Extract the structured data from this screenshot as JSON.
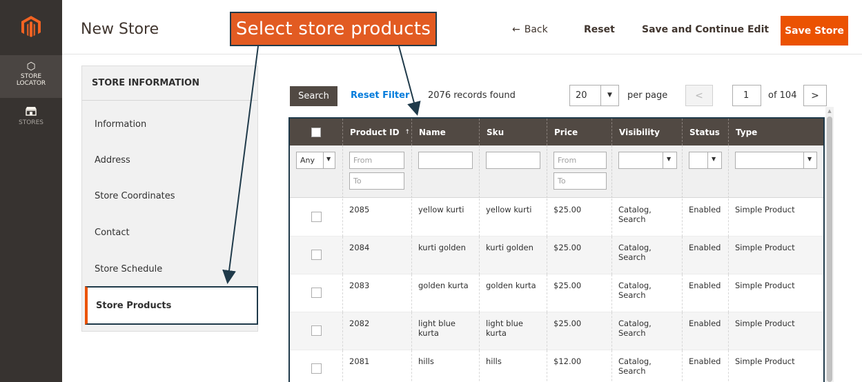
{
  "nav": {
    "items": [
      {
        "label_1": "STORE",
        "label_2": "LOCATOR",
        "icon": "hexagon-icon"
      },
      {
        "label_1": "STORES",
        "icon": "storefront-icon"
      }
    ]
  },
  "header": {
    "title": "New Store",
    "back_label": "Back",
    "reset_label": "Reset",
    "save_continue_label": "Save and Continue Edit",
    "save_label": "Save Store"
  },
  "callout": {
    "text": "Select store products",
    "color": "#e25b22"
  },
  "store_info": {
    "title": "STORE INFORMATION",
    "items": [
      "Information",
      "Address",
      "Store Coordinates",
      "Contact",
      "Store Schedule",
      "Store Products"
    ],
    "active": "Store Products"
  },
  "toolbar": {
    "search_label": "Search",
    "reset_filter_label": "Reset Filter",
    "records_text": "2076 records found",
    "per_page_value": "20",
    "per_page_label": "per page",
    "page_value": "1",
    "page_of": "of 104"
  },
  "grid": {
    "columns": [
      "Product ID",
      "Name",
      "Sku",
      "Price",
      "Visibility",
      "Status",
      "Type"
    ],
    "filters": {
      "select_any": "Any",
      "from_placeholder": "From",
      "to_placeholder": "To"
    },
    "rows": [
      {
        "id": "2085",
        "name": "yellow kurti",
        "sku": "yellow kurti",
        "price": "$25.00",
        "visibility": "Catalog, Search",
        "status": "Enabled",
        "type": "Simple Product"
      },
      {
        "id": "2084",
        "name": "kurti golden",
        "sku": "kurti golden",
        "price": "$25.00",
        "visibility": "Catalog, Search",
        "status": "Enabled",
        "type": "Simple Product"
      },
      {
        "id": "2083",
        "name": "golden kurta",
        "sku": "golden kurta",
        "price": "$25.00",
        "visibility": "Catalog, Search",
        "status": "Enabled",
        "type": "Simple Product"
      },
      {
        "id": "2082",
        "name": "light blue kurta",
        "sku": "light blue kurta",
        "price": "$25.00",
        "visibility": "Catalog, Search",
        "status": "Enabled",
        "type": "Simple Product"
      },
      {
        "id": "2081",
        "name": "hills",
        "sku": "hills",
        "price": "$12.00",
        "visibility": "Catalog, Search",
        "status": "Enabled",
        "type": "Simple Product"
      }
    ]
  },
  "colors": {
    "accent": "#eb5202",
    "nav_bg": "#373330",
    "grid_header": "#514943",
    "link": "#007bdb",
    "highlight_border": "#1f3a4a"
  }
}
